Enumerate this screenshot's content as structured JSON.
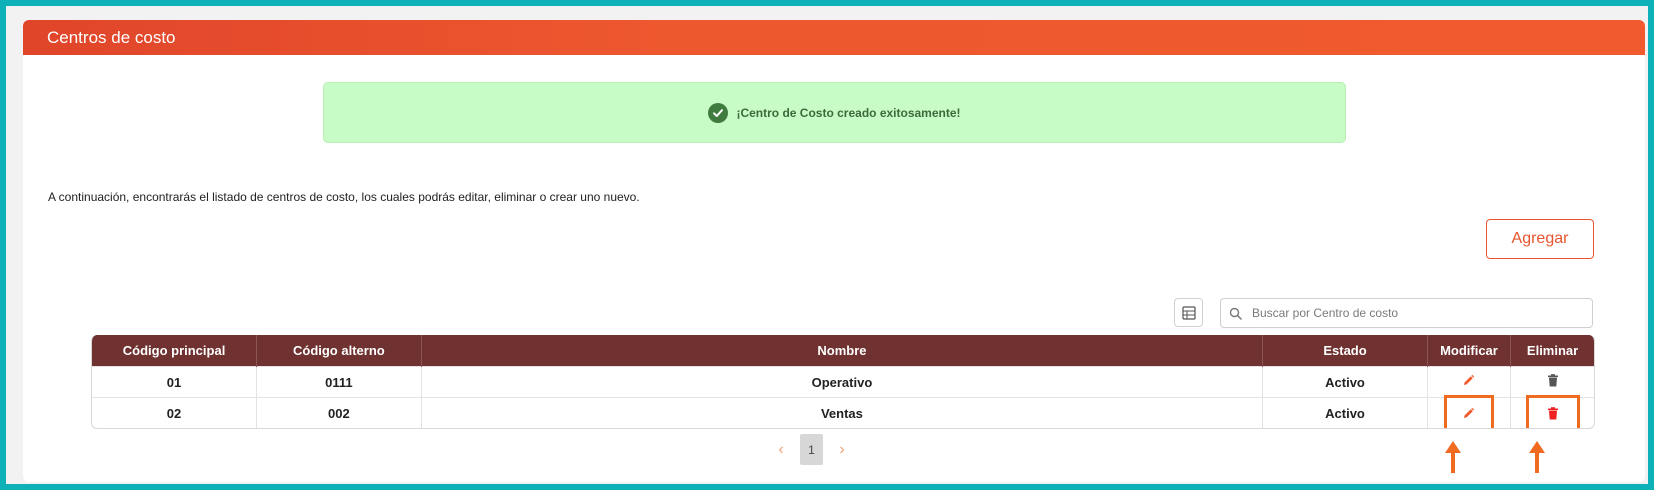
{
  "header": {
    "title": "Centros de costo"
  },
  "alert": {
    "message": "¡Centro de Costo creado exitosamente!",
    "icon": "check-circle-icon",
    "color": "#c8fcc6"
  },
  "description": "A continuación, encontrarás el listado de centros de costo, los cuales podrás editar, eliminar o crear uno nuevo.",
  "actions": {
    "add_label": "Agregar",
    "export_icon": "export-excel-icon"
  },
  "search": {
    "placeholder": "Buscar por Centro de costo",
    "value": ""
  },
  "table": {
    "columns": [
      "Código principal",
      "Código alterno",
      "Nombre",
      "Estado",
      "Modificar",
      "Eliminar"
    ],
    "rows": [
      {
        "codigo_principal": "01",
        "codigo_alterno": "0111",
        "nombre": "Operativo",
        "estado": "Activo"
      },
      {
        "codigo_principal": "02",
        "codigo_alterno": "002",
        "nombre": "Ventas",
        "estado": "Activo"
      }
    ]
  },
  "pagination": {
    "current_page": "1"
  },
  "colors": {
    "brand": "#f05a2e",
    "table_header": "#6f3230",
    "annotation": "#f06a1f"
  }
}
